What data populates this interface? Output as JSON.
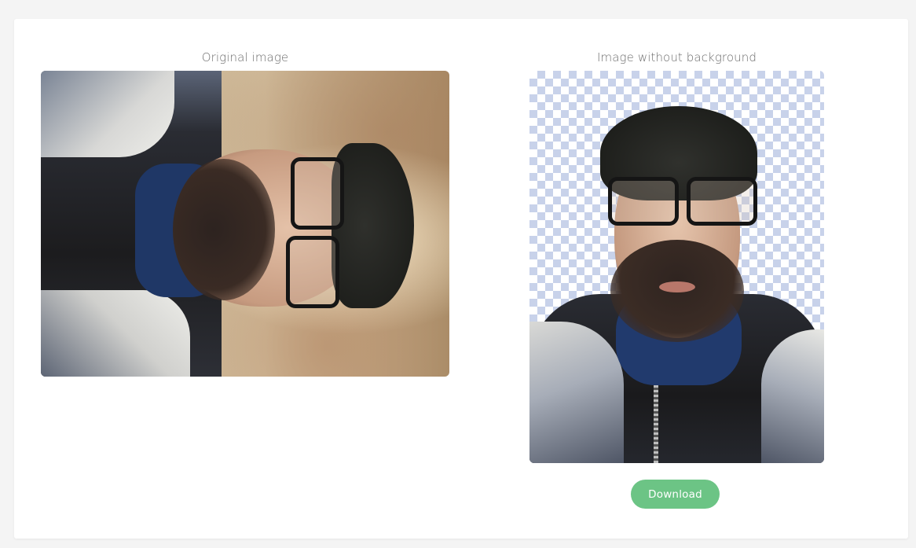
{
  "panels": {
    "original": {
      "title": "Original image"
    },
    "result": {
      "title": "Image without background",
      "download_label": "Download"
    }
  },
  "colors": {
    "page_bg": "#f4f4f4",
    "card_bg": "#ffffff",
    "download_button": "#6cc485",
    "transparency_checker": "#c8d2ea"
  }
}
